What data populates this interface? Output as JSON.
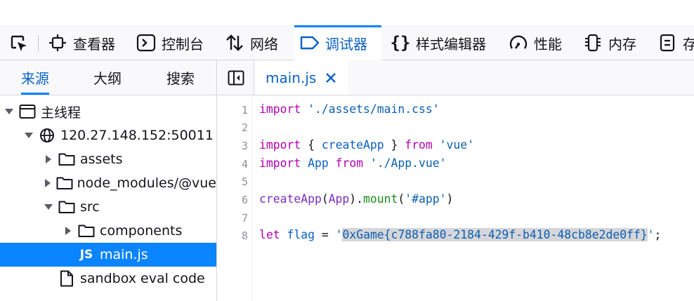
{
  "toolbar": {
    "tabs": [
      {
        "label": "查看器",
        "icon": "inspector-icon"
      },
      {
        "label": "控制台",
        "icon": "console-icon"
      },
      {
        "label": "网络",
        "icon": "network-icon"
      },
      {
        "label": "调试器",
        "icon": "debugger-icon",
        "active": true
      },
      {
        "label": "样式编辑器",
        "icon": "style-editor-icon"
      },
      {
        "label": "性能",
        "icon": "performance-icon"
      },
      {
        "label": "内存",
        "icon": "memory-icon"
      },
      {
        "label": "存",
        "icon": "storage-icon"
      }
    ],
    "accent": "#0a84ff"
  },
  "sources_panel": {
    "tabs": [
      "来源",
      "大纲",
      "搜索"
    ],
    "active_tab": "来源",
    "tree": [
      {
        "label": "主线程",
        "icon": "window-icon",
        "expanded": true
      },
      {
        "label": "120.27.148.152:50011",
        "icon": "globe-icon",
        "expanded": true
      },
      {
        "label": "assets",
        "icon": "folder-icon",
        "expanded": false
      },
      {
        "label": "node_modules/@vue",
        "icon": "folder-icon",
        "expanded": false
      },
      {
        "label": "src",
        "icon": "folder-icon",
        "expanded": true
      },
      {
        "label": "components",
        "icon": "folder-icon",
        "expanded": false
      },
      {
        "label": "main.js",
        "icon": "js-file-icon",
        "icon_text": "JS",
        "selected": true
      },
      {
        "label": "sandbox eval code",
        "icon": "file-icon"
      }
    ]
  },
  "editor": {
    "open_tab": "main.js",
    "line_numbers": [
      "1",
      "2",
      "3",
      "4",
      "5",
      "6",
      "7",
      "8"
    ],
    "lines": [
      "import './assets/main.css'",
      "",
      "import { createApp } from 'vue'",
      "import App from './App.vue'",
      "",
      "createApp(App).mount('#app')",
      "",
      "let flag = '0xGame{c788fa80-2184-429f-b410-48cb8e2de0ff}';"
    ],
    "tokens": {
      "l1": {
        "kw": "import",
        "str": "'./assets/main.css'"
      },
      "l3": {
        "kw1": "import",
        "p1": "{",
        "id": "createApp",
        "p2": "}",
        "kw2": "from",
        "str": "'vue'"
      },
      "l4": {
        "kw1": "import",
        "id": "App",
        "kw2": "from",
        "str": "'./App.vue'"
      },
      "l6": {
        "fn": "createApp",
        "p1": "(",
        "arg": "App",
        "p2": ").",
        "method": "mount",
        "p3": "(",
        "str": "'#app'",
        "p4": ")"
      },
      "l8": {
        "kw": "let",
        "var": "flag",
        "eq": "=",
        "q1": "'",
        "flag": "0xGame{c788fa80-2184-429f-b410-48cb8e2de0ff}",
        "q2": "'",
        "semi": ";"
      }
    },
    "selection_color": "#d6d6da"
  }
}
